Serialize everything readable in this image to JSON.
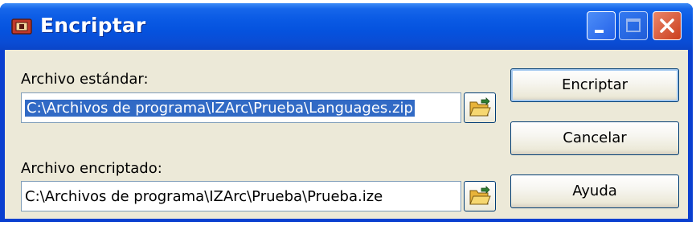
{
  "window": {
    "title": "Encriptar"
  },
  "form": {
    "standard_label": "Archivo estándar:",
    "standard_value": "C:\\Archivos de programa\\IZArc\\Prueba\\Languages.zip",
    "encrypted_label": "Archivo encriptado:",
    "encrypted_value": "C:\\Archivos de programa\\IZArc\\Prueba\\Prueba.ize"
  },
  "buttons": {
    "encrypt": "Encriptar",
    "cancel": "Cancelar",
    "help": "Ayuda"
  },
  "colors": {
    "titlebar": "#0a5ae4",
    "client": "#ece9d8",
    "selection": "#316ac5",
    "close_button": "#cb3e1d"
  },
  "icons": {
    "title": "app-icon",
    "browse": "folder-open-icon"
  }
}
